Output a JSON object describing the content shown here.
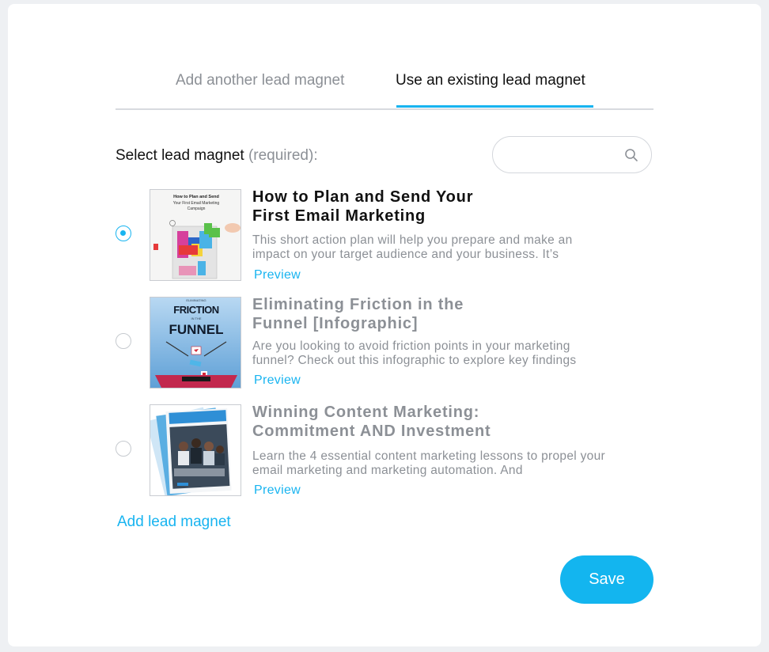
{
  "tabs": [
    {
      "label": "Add another lead magnet",
      "active": false
    },
    {
      "label": "Use an existing lead magnet",
      "active": true
    }
  ],
  "select": {
    "label": "Select lead magnet",
    "required": "(required):"
  },
  "search": {
    "placeholder": "",
    "icon": "search-icon"
  },
  "items": [
    {
      "title": "How to Plan and Send Your First Email Marketing Campaign",
      "description": "This short action plan will help you prepare and make an impact on your target audience and your business. It’s",
      "preview": "Preview",
      "selected": true,
      "thumb": {
        "line1": "How to Plan and Send",
        "line2": "Your First Email Marketing",
        "line3": "Campaign"
      }
    },
    {
      "title": "Eliminating Friction in the Funnel [Infographic]",
      "description": "Are you looking to avoid friction points in your marketing funnel? Check out this infographic to explore key findings",
      "preview": "Preview",
      "selected": false,
      "thumb": {
        "top": "ELIMINATING",
        "word1": "FRICTION",
        "mid": "IN THE",
        "word2": "FUNNEL"
      }
    },
    {
      "title": "Winning Content Marketing: Commitment AND Investment",
      "description": "Learn the 4 essential content marketing lessons to propel your email marketing and marketing automation. And",
      "preview": "Preview",
      "selected": false,
      "thumb": {}
    }
  ],
  "add_link": "Add lead magnet",
  "save_label": "Save",
  "colors": {
    "accent": "#18b4f0",
    "muted": "#8c9096"
  }
}
